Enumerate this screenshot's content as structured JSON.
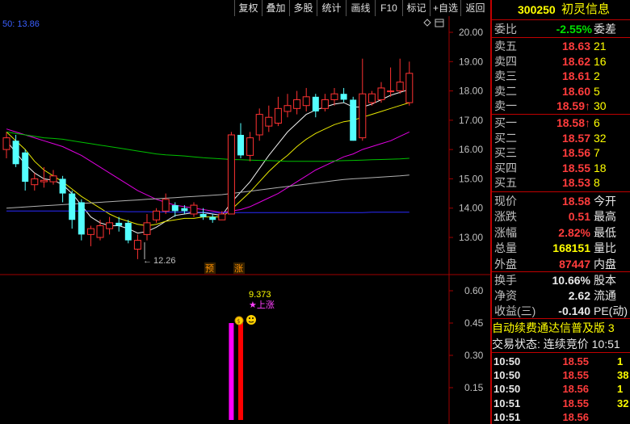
{
  "toolbar": {
    "buttons": [
      "复权",
      "叠加",
      "多股",
      "统计",
      "画线",
      "F10",
      "标记",
      "+自选",
      "返回"
    ]
  },
  "chart": {
    "ma_label": "50: 13.86",
    "price_axis": [
      "20.00",
      "19.00",
      "18.00",
      "17.00",
      "16.00",
      "15.00",
      "14.00",
      "13.00"
    ],
    "low_marker": "12.26",
    "badges": [
      "预",
      "涨"
    ],
    "indicator_axis": [
      "0.60",
      "0.45",
      "0.30",
      "0.15"
    ],
    "indicator_value": "9.373",
    "indicator_signal": "★上涨"
  },
  "panel": {
    "code": "300250",
    "name": "初灵信息",
    "weibi_label": "委比",
    "weibi_value": "-2.55%",
    "weicha_label": "委差",
    "asks": [
      {
        "label": "卖五",
        "price": "18.63",
        "vol": "21"
      },
      {
        "label": "卖四",
        "price": "18.62",
        "vol": "16"
      },
      {
        "label": "卖三",
        "price": "18.61",
        "vol": "2"
      },
      {
        "label": "卖二",
        "price": "18.60",
        "vol": "5"
      },
      {
        "label": "卖一",
        "price": "18.59↑",
        "vol": "30"
      }
    ],
    "bids": [
      {
        "label": "买一",
        "price": "18.58↑",
        "vol": "6"
      },
      {
        "label": "买二",
        "price": "18.57",
        "vol": "32"
      },
      {
        "label": "买三",
        "price": "18.56",
        "vol": "7"
      },
      {
        "label": "买四",
        "price": "18.55",
        "vol": "18"
      },
      {
        "label": "买五",
        "price": "18.53",
        "vol": "8"
      }
    ],
    "stats": [
      {
        "label": "现价",
        "value": "18.58",
        "extra": "今开"
      },
      {
        "label": "涨跌",
        "value": "0.51",
        "extra": "最高"
      },
      {
        "label": "涨幅",
        "value": "2.82%",
        "extra": "最低"
      },
      {
        "label": "总量",
        "value": "168151",
        "extra": "量比"
      },
      {
        "label": "外盘",
        "value": "87447",
        "extra": "内盘"
      }
    ],
    "stats2": [
      {
        "label": "换手",
        "value": "10.66%",
        "extra": "股本"
      },
      {
        "label": "净资",
        "value": "2.62",
        "extra": "流通"
      },
      {
        "label": "收益(三)",
        "value": "-0.140",
        "extra": "PE(动)"
      }
    ],
    "ticker_text": "自动续费通达信普及版 3",
    "trade_status": "交易状态: 连续竞价 10:51",
    "ticks": [
      {
        "time": "10:50",
        "price": "18.55",
        "vol": "1"
      },
      {
        "time": "10:50",
        "price": "18.55",
        "vol": "38"
      },
      {
        "time": "10:50",
        "price": "18.56",
        "vol": "1"
      },
      {
        "time": "10:51",
        "price": "18.55",
        "vol": "32"
      },
      {
        "time": "10:51",
        "price": "18.56",
        "vol": ""
      }
    ]
  },
  "chart_data": [
    {
      "type": "candlestick",
      "ylim": [
        12.0,
        20.5
      ],
      "candles": [
        {
          "o": 16.0,
          "c": 16.4,
          "h": 16.6,
          "l": 15.7
        },
        {
          "o": 16.3,
          "c": 15.5,
          "h": 16.5,
          "l": 15.4
        },
        {
          "o": 15.9,
          "c": 14.9,
          "h": 16.0,
          "l": 14.6
        },
        {
          "o": 14.8,
          "c": 15.0,
          "h": 15.2,
          "l": 14.6
        },
        {
          "o": 14.9,
          "c": 14.95,
          "h": 15.4,
          "l": 14.7
        },
        {
          "o": 14.9,
          "c": 15.1,
          "h": 15.3,
          "l": 14.8
        },
        {
          "o": 15.0,
          "c": 14.5,
          "h": 15.1,
          "l": 14.2
        },
        {
          "o": 14.5,
          "c": 13.6,
          "h": 14.6,
          "l": 13.3
        },
        {
          "o": 14.2,
          "c": 13.1,
          "h": 14.3,
          "l": 12.9
        },
        {
          "o": 13.1,
          "c": 13.3,
          "h": 13.4,
          "l": 12.7
        },
        {
          "o": 13.0,
          "c": 13.4,
          "h": 13.6,
          "l": 12.9
        },
        {
          "o": 13.3,
          "c": 13.5,
          "h": 13.7,
          "l": 13.1
        },
        {
          "o": 13.5,
          "c": 13.4,
          "h": 13.7,
          "l": 13.2
        },
        {
          "o": 13.5,
          "c": 12.9,
          "h": 13.6,
          "l": 12.8
        },
        {
          "o": 12.6,
          "c": 12.9,
          "h": 13.1,
          "l": 12.26
        },
        {
          "o": 13.1,
          "c": 13.5,
          "h": 13.8,
          "l": 12.9
        },
        {
          "o": 13.6,
          "c": 13.9,
          "h": 14.0,
          "l": 13.5
        },
        {
          "o": 13.9,
          "c": 14.3,
          "h": 14.5,
          "l": 13.8
        },
        {
          "o": 14.1,
          "c": 13.9,
          "h": 14.2,
          "l": 13.7
        },
        {
          "o": 14.0,
          "c": 13.9,
          "h": 14.1,
          "l": 13.8
        },
        {
          "o": 13.8,
          "c": 14.1,
          "h": 14.2,
          "l": 13.7
        },
        {
          "o": 13.8,
          "c": 13.7,
          "h": 14.0,
          "l": 13.6
        },
        {
          "o": 13.7,
          "c": 13.6,
          "h": 13.8,
          "l": 13.5
        },
        {
          "o": 13.6,
          "c": 13.8,
          "h": 13.9,
          "l": 13.6
        },
        {
          "o": 13.8,
          "c": 16.5,
          "h": 16.6,
          "l": 13.8
        },
        {
          "o": 16.5,
          "c": 15.8,
          "h": 16.9,
          "l": 15.7
        },
        {
          "o": 15.8,
          "c": 16.4,
          "h": 16.6,
          "l": 15.6
        },
        {
          "o": 16.5,
          "c": 17.2,
          "h": 17.4,
          "l": 16.3
        },
        {
          "o": 16.8,
          "c": 17.1,
          "h": 17.5,
          "l": 16.6
        },
        {
          "o": 16.9,
          "c": 17.4,
          "h": 17.8,
          "l": 16.8
        },
        {
          "o": 17.3,
          "c": 17.5,
          "h": 17.9,
          "l": 17.1
        },
        {
          "o": 17.4,
          "c": 17.7,
          "h": 18.0,
          "l": 17.2
        },
        {
          "o": 17.5,
          "c": 17.8,
          "h": 18.1,
          "l": 17.3
        },
        {
          "o": 17.8,
          "c": 17.3,
          "h": 17.9,
          "l": 17.1
        },
        {
          "o": 17.4,
          "c": 17.7,
          "h": 17.9,
          "l": 17.3
        },
        {
          "o": 17.7,
          "c": 17.9,
          "h": 18.1,
          "l": 17.5
        },
        {
          "o": 17.9,
          "c": 17.7,
          "h": 18.1,
          "l": 17.6
        },
        {
          "o": 17.7,
          "c": 16.3,
          "h": 17.8,
          "l": 16.3
        },
        {
          "o": 16.4,
          "c": 17.9,
          "h": 19.1,
          "l": 16.3
        },
        {
          "o": 17.6,
          "c": 17.9,
          "h": 18.0,
          "l": 17.5
        },
        {
          "o": 17.7,
          "c": 18.1,
          "h": 18.3,
          "l": 17.6
        },
        {
          "o": 18.0,
          "c": 18.0,
          "h": 18.8,
          "l": 17.8
        },
        {
          "o": 18.0,
          "c": 18.3,
          "h": 19.1,
          "l": 17.9
        },
        {
          "o": 17.6,
          "c": 18.6,
          "h": 19.0,
          "l": 17.5
        }
      ],
      "ma": {
        "white": [
          16.3,
          15.9,
          15.5,
          15.2,
          15.0,
          14.95,
          14.8,
          14.5,
          14.1,
          13.7,
          13.5,
          13.4,
          13.4,
          13.3,
          13.15,
          13.2,
          13.35,
          13.55,
          13.75,
          13.8,
          13.85,
          13.85,
          13.8,
          13.75,
          14.2,
          14.55,
          14.9,
          15.35,
          15.8,
          16.2,
          16.6,
          16.9,
          17.2,
          17.35,
          17.45,
          17.55,
          17.6,
          17.45,
          17.45,
          17.55,
          17.7,
          17.85,
          17.95,
          18.05
        ],
        "yellow": [
          16.6,
          16.3,
          16.0,
          15.6,
          15.3,
          15.1,
          14.9,
          14.65,
          14.4,
          14.2,
          14.0,
          13.8,
          13.65,
          13.55,
          13.45,
          13.4,
          13.45,
          13.55,
          13.6,
          13.65,
          13.65,
          13.7,
          13.7,
          13.7,
          13.95,
          14.25,
          14.55,
          14.9,
          15.25,
          15.55,
          15.8,
          16.1,
          16.35,
          16.55,
          16.7,
          16.85,
          16.95,
          17.0,
          17.1,
          17.2,
          17.3,
          17.4,
          17.5,
          17.6
        ],
        "magenta": [
          16.7,
          16.6,
          16.5,
          16.4,
          16.3,
          16.2,
          16.1,
          15.95,
          15.8,
          15.6,
          15.4,
          15.2,
          15.0,
          14.8,
          14.6,
          14.45,
          14.3,
          14.2,
          14.1,
          14.05,
          14.0,
          13.95,
          13.9,
          13.85,
          13.9,
          13.95,
          14.05,
          14.2,
          14.35,
          14.5,
          14.7,
          14.9,
          15.1,
          15.3,
          15.45,
          15.6,
          15.75,
          15.85,
          16.0,
          16.1,
          16.2,
          16.3,
          16.45,
          16.6
        ],
        "green": [
          16.6,
          16.55,
          16.5,
          16.45,
          16.4,
          16.38,
          16.35,
          16.3,
          16.25,
          16.2,
          16.15,
          16.1,
          16.05,
          16.0,
          15.95,
          15.9,
          15.85,
          15.82,
          15.8,
          15.78,
          15.75,
          15.72,
          15.7,
          15.68,
          15.66,
          15.65,
          15.64,
          15.63,
          15.62,
          15.61,
          15.6,
          15.6,
          15.6,
          15.6,
          15.6,
          15.61,
          15.62,
          15.63,
          15.64,
          15.65,
          15.66,
          15.67,
          15.68,
          15.7
        ],
        "gray": [
          14.0,
          14.02,
          14.04,
          14.06,
          14.08,
          14.1,
          14.12,
          14.14,
          14.16,
          14.18,
          14.2,
          14.22,
          14.24,
          14.26,
          14.28,
          14.3,
          14.32,
          14.34,
          14.36,
          14.38,
          14.4,
          14.42,
          14.44,
          14.46,
          14.5,
          14.54,
          14.58,
          14.62,
          14.66,
          14.7,
          14.74,
          14.78,
          14.82,
          14.86,
          14.9,
          14.94,
          14.98,
          15.0,
          15.02,
          15.04,
          15.06,
          15.08,
          15.1,
          15.13
        ],
        "blue": [
          13.9,
          13.9,
          13.9,
          13.9,
          13.9,
          13.9,
          13.9,
          13.9,
          13.9,
          13.9,
          13.89,
          13.89,
          13.89,
          13.88,
          13.88,
          13.88,
          13.87,
          13.87,
          13.86,
          13.86,
          13.86,
          13.86,
          13.85,
          13.85,
          13.85,
          13.85,
          13.85,
          13.85,
          13.85,
          13.85,
          13.85,
          13.85,
          13.85,
          13.85,
          13.85,
          13.85,
          13.85,
          13.85,
          13.85,
          13.86,
          13.86,
          13.86,
          13.86,
          13.86
        ]
      }
    },
    {
      "type": "bar",
      "ylim": [
        0,
        0.65
      ],
      "bars": [
        {
          "index": 24,
          "value": 0.45,
          "color": "#ff00ff"
        },
        {
          "index": 25,
          "value": 0.45,
          "color": "#ff0000"
        }
      ]
    }
  ]
}
